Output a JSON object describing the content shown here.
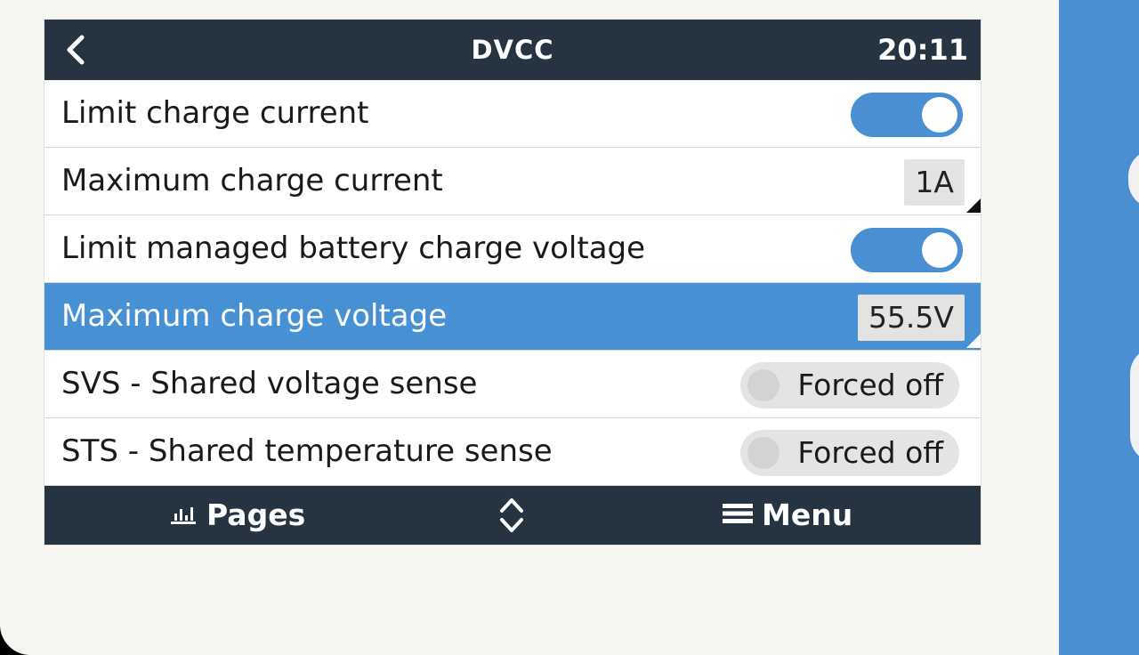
{
  "header": {
    "title": "DVCC",
    "time": "20:11"
  },
  "rows": [
    {
      "label": "Limit charge current",
      "control": "toggle",
      "on": true
    },
    {
      "label": "Maximum charge current",
      "control": "value",
      "value": "1A"
    },
    {
      "label": "Limit managed battery charge voltage",
      "control": "toggle",
      "on": true
    },
    {
      "label": "Maximum charge voltage",
      "control": "value",
      "value": "55.5V",
      "selected": true
    },
    {
      "label": "SVS - Shared voltage sense",
      "control": "state",
      "value": "Forced off"
    },
    {
      "label": "STS - Shared temperature sense",
      "control": "state",
      "value": "Forced off"
    }
  ],
  "footer": {
    "pages_label": "Pages",
    "menu_label": "Menu",
    "pages_icon": "bar-chart-icon",
    "updown_icon": "chevron-up-down-icon",
    "menu_icon": "hamburger-menu-icon"
  },
  "colors": {
    "header_bg": "#263340",
    "accent": "#4a8fd1",
    "selected_row": "#4790d4"
  }
}
